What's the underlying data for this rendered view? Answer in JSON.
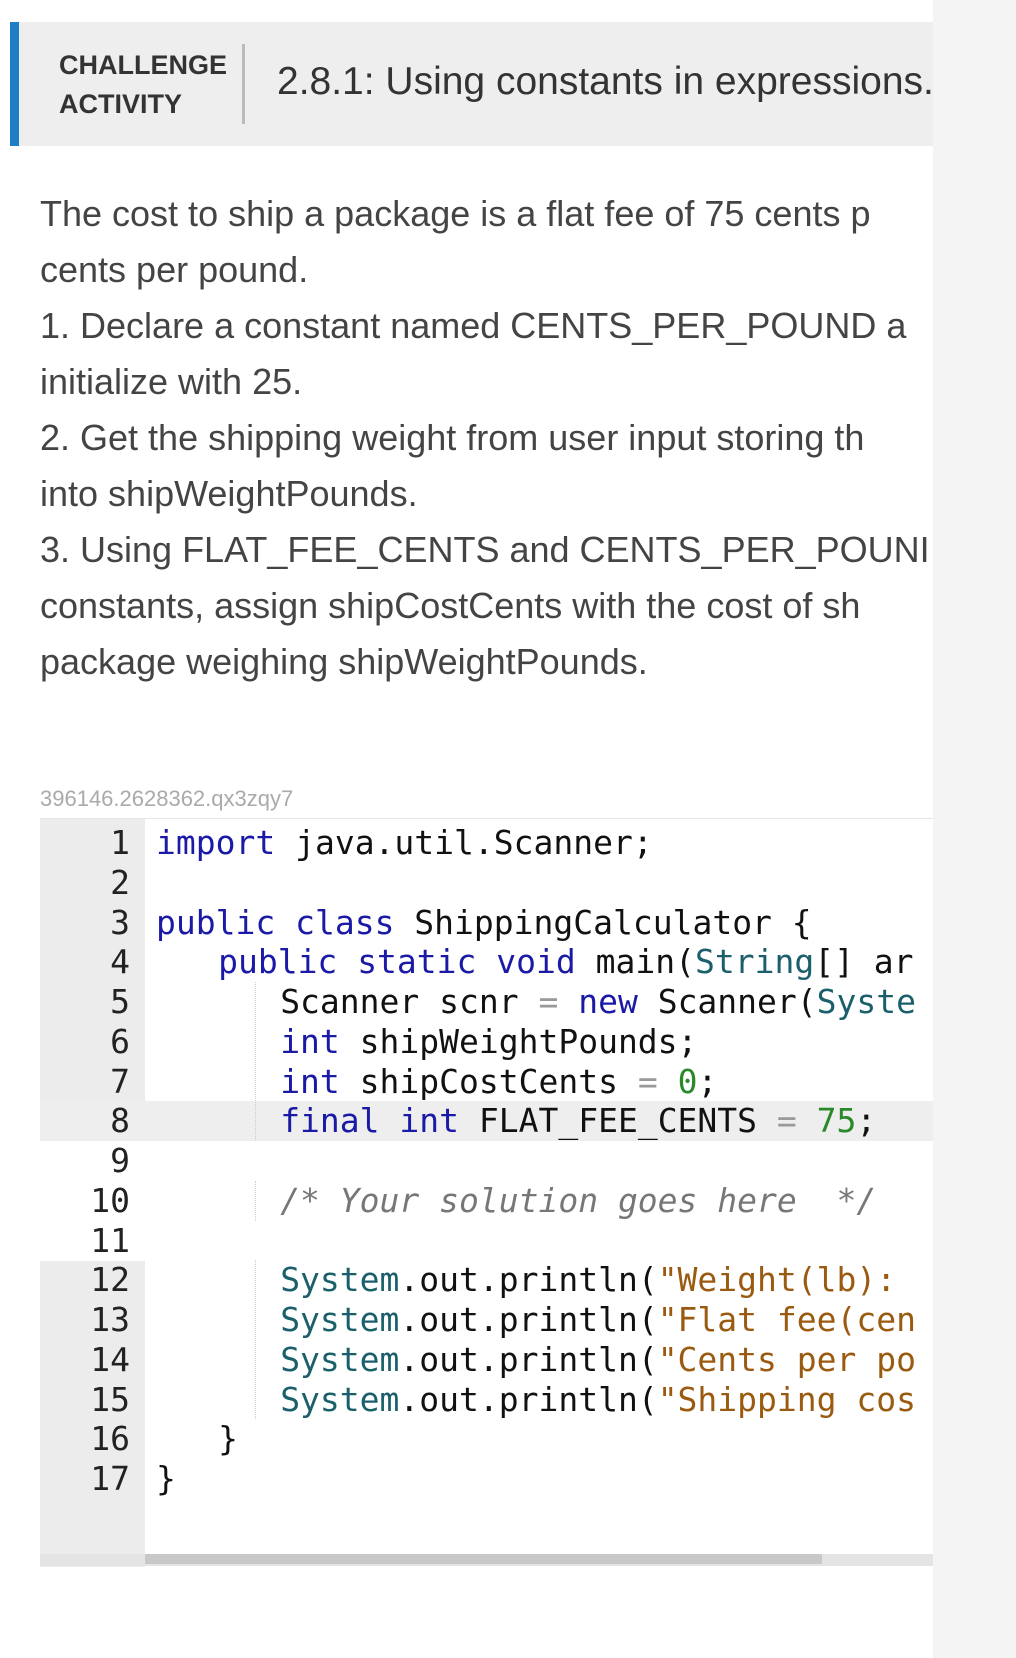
{
  "header": {
    "label_line1": "CHALLENGE",
    "label_line2": "ACTIVITY",
    "title": "2.8.1: Using constants in expressions.",
    "accent": "#1d7ec5"
  },
  "description": [
    "The cost to ship a package is a flat fee of 75 cents p",
    "cents per pound.",
    "1. Declare a constant named CENTS_PER_POUND a",
    "initialize with 25.",
    "2. Get the shipping weight from user input storing th",
    "into shipWeightPounds.",
    "3. Using FLAT_FEE_CENTS and CENTS_PER_POUNI",
    "constants, assign shipCostCents with the cost of sh",
    "package weighing shipWeightPounds."
  ],
  "code_id": "396146.2628362.qx3zqy7",
  "editor": {
    "line_numbers": [
      "1",
      "2",
      "3",
      "4",
      "5",
      "6",
      "7",
      "8",
      "9",
      "10",
      "11",
      "12",
      "13",
      "14",
      "15",
      "16",
      "17"
    ],
    "active_line": 8,
    "tokens": {
      "l1": [
        "import",
        " java.util.Scanner;"
      ],
      "l3": [
        "public",
        " ",
        "class",
        " ShippingCalculator {"
      ],
      "l4": [
        "public",
        " ",
        "static",
        " ",
        "void",
        " main(",
        "String",
        "[] ar"
      ],
      "l5": [
        "Scanner scnr ",
        "=",
        " ",
        "new",
        " Scanner(",
        "Syste"
      ],
      "l6": [
        "int",
        " shipWeightPounds;"
      ],
      "l7": [
        "int",
        " shipCostCents ",
        "=",
        " ",
        "0",
        ";"
      ],
      "l8": [
        "final",
        " ",
        "int",
        " FLAT_FEE_CENTS ",
        "=",
        " ",
        "75",
        ";"
      ],
      "l10": "/* Your solution goes here  */",
      "l12": [
        "System",
        ".out.println(",
        "\"Weight(lb): "
      ],
      "l13": [
        "System",
        ".out.println(",
        "\"Flat fee(cen"
      ],
      "l14": [
        "System",
        ".out.println(",
        "\"Cents per po"
      ],
      "l15": [
        "System",
        ".out.println(",
        "\"Shipping cos"
      ],
      "l16": "}",
      "l17": "}"
    }
  }
}
